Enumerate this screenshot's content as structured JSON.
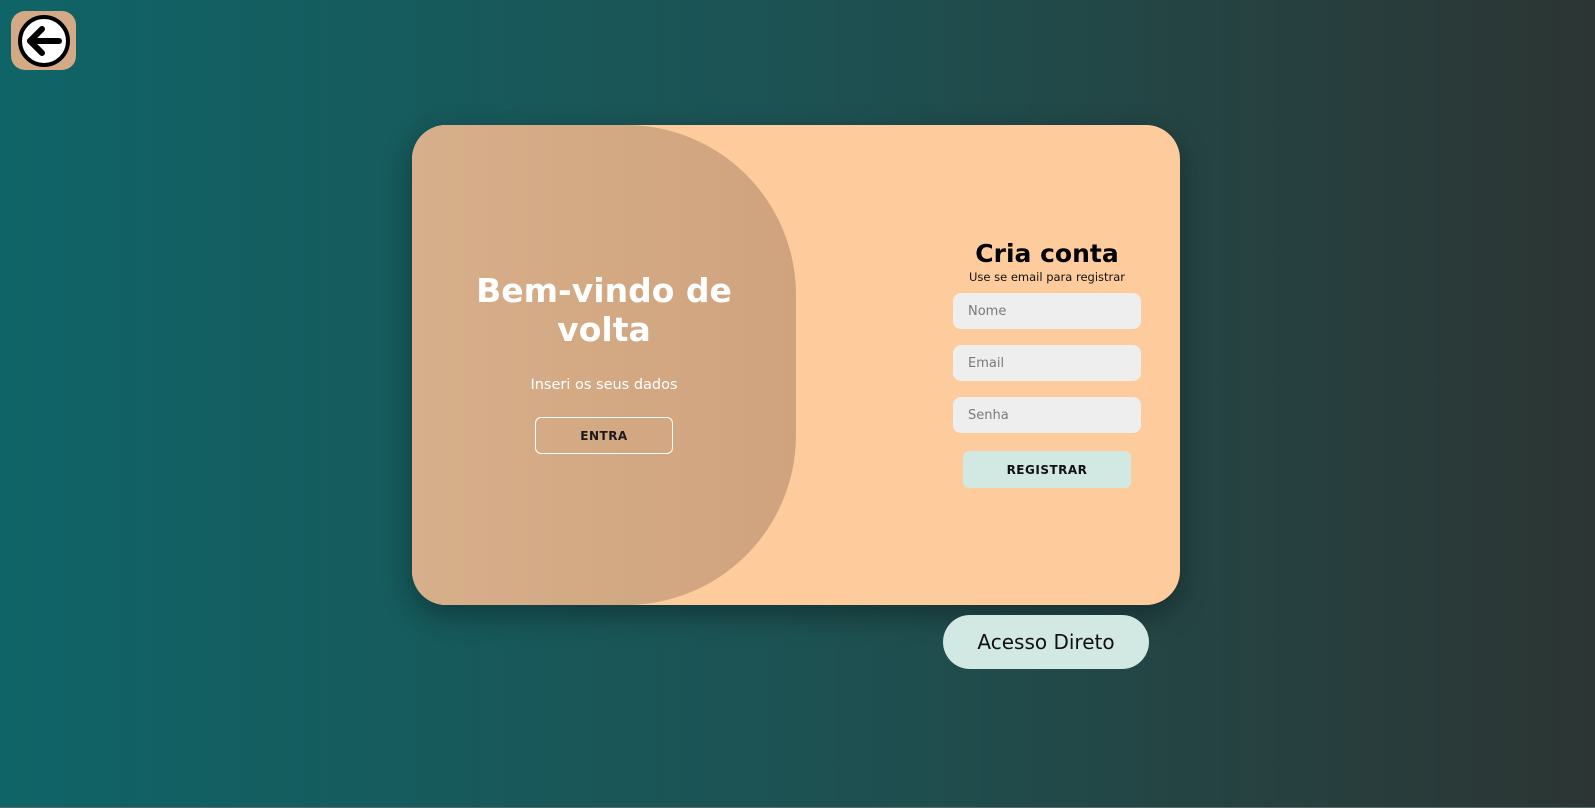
{
  "back_button": {
    "icon": "arrow-left-circle-icon"
  },
  "welcome": {
    "title": "Bem-vindo de volta",
    "subtitle": "Inseri os seus dados",
    "enter_label": "ENTRA"
  },
  "register": {
    "title": "Cria conta",
    "subtitle": "Use se email para registrar",
    "name_placeholder": "Nome",
    "email_placeholder": "Email",
    "password_placeholder": "Senha",
    "submit_label": "REGISTRAR"
  },
  "direct_access_label": "Acesso Direto",
  "colors": {
    "background_start": "#0f6467",
    "background_end": "#2c3533",
    "card": "#fecb9c",
    "welcome_panel": "#d4aa86",
    "button_mint": "#d2e8e3",
    "input": "#eeeeee"
  }
}
